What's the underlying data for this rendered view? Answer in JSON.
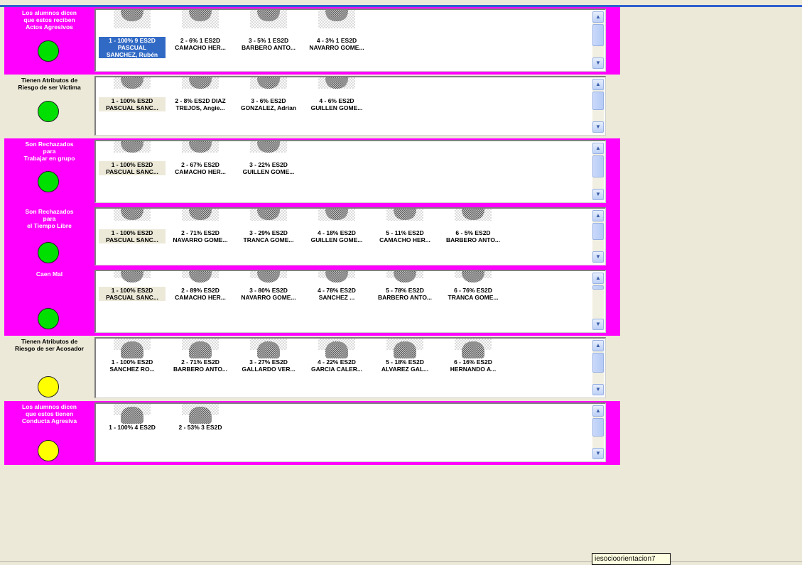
{
  "sections": [
    {
      "title": "Los alumnos dicen\nque estos reciben\nActos Agresivos",
      "status": "green",
      "bg": "#ff00ff",
      "items": [
        {
          "line1": "1 - 100% 9 ES2D",
          "line2": "PASCUAL",
          "line3": "SANCHEZ, Rubén",
          "selected": true
        },
        {
          "line1": "2 - 6% 1 ES2D",
          "line2": "CAMACHO HER..."
        },
        {
          "line1": "3 - 5% 1 ES2D",
          "line2": "BARBERO ANTO..."
        },
        {
          "line1": "4 - 3% 1 ES2D",
          "line2": "NAVARRO GOME..."
        }
      ]
    },
    {
      "title": "Tienen Atributos de\nRiesgo de ser Víctima",
      "status": "green",
      "bg": "#ece9d8",
      "items": [
        {
          "line1": "1 - 100% ES2D",
          "line2": "PASCUAL SANC...",
          "highlight": true
        },
        {
          "line1": "2 - 8% ES2D DIAZ",
          "line2": "TREJOS, Angie..."
        },
        {
          "line1": "3 - 6% ES2D",
          "line2": "GONZALEZ, Adrian"
        },
        {
          "line1": "4 - 6% ES2D",
          "line2": "GUILLEN GOME..."
        }
      ]
    },
    {
      "title": "Son Rechazados\npara\nTrabajar en grupo",
      "status": "green",
      "bg": "#ff00ff",
      "items": [
        {
          "line1": "1 - 100% ES2D",
          "line2": "PASCUAL SANC...",
          "highlight": true
        },
        {
          "line1": "2 - 67% ES2D",
          "line2": "CAMACHO HER..."
        },
        {
          "line1": "3 - 22% ES2D",
          "line2": "GUILLEN GOME..."
        }
      ]
    },
    {
      "title": "Son Rechazados\npara\nel Tiempo Libre",
      "status": "green",
      "bg": "#ff00ff",
      "items": [
        {
          "line1": "1 - 100% ES2D",
          "line2": "PASCUAL SANC...",
          "highlight": true
        },
        {
          "line1": "2 - 71% ES2D",
          "line2": "NAVARRO GOME..."
        },
        {
          "line1": "3 - 29% ES2D",
          "line2": "TRANCA GOME..."
        },
        {
          "line1": "4 - 18% ES2D",
          "line2": "GUILLEN GOME..."
        },
        {
          "line1": "5 - 11% ES2D",
          "line2": "CAMACHO HER..."
        },
        {
          "line1": "6 - 5% ES2D",
          "line2": "BARBERO ANTO..."
        }
      ]
    },
    {
      "title": "Caen Mal",
      "status": "green",
      "bg": "#ff00ff",
      "items": [
        {
          "line1": "1 - 100% ES2D",
          "line2": "PASCUAL SANC...",
          "highlight": true
        },
        {
          "line1": "2 - 89% ES2D",
          "line2": "CAMACHO HER..."
        },
        {
          "line1": "3 - 80% ES2D",
          "line2": "NAVARRO GOME..."
        },
        {
          "line1": "4 - 78% ES2D",
          "line2": "SANCHEZ ..."
        },
        {
          "line1": "5 - 78% ES2D",
          "line2": "BARBERO ANTO..."
        },
        {
          "line1": "6 - 76% ES2D",
          "line2": "TRANCA GOME..."
        }
      ]
    },
    {
      "title": "Tienen Atributos de\nRiesgo de ser Acosador",
      "status": "yellow",
      "bg": "#ece9d8",
      "items": [
        {
          "line1": "1 - 100% ES2D",
          "line2": "SANCHEZ RO..."
        },
        {
          "line1": "2 - 71% ES2D",
          "line2": "BARBERO ANTO..."
        },
        {
          "line1": "3 - 27% ES2D",
          "line2": "GALLARDO VER..."
        },
        {
          "line1": "4 - 22% ES2D",
          "line2": "GARCIA CALER..."
        },
        {
          "line1": "5 - 18% ES2D",
          "line2": "ALVAREZ GAL..."
        },
        {
          "line1": "6 - 16% ES2D",
          "line2": "HERNANDO A..."
        }
      ]
    },
    {
      "title": "Los alumnos dicen\nque estos tienen\nConducta Agresiva",
      "status": "yellow",
      "bg": "#ff00ff",
      "items": [
        {
          "line1": "1 - 100% 4 ES2D",
          "line2": ""
        },
        {
          "line1": "2 - 53% 3 ES2D",
          "line2": ""
        }
      ]
    }
  ],
  "tooltip": "iesocioorientacion7"
}
